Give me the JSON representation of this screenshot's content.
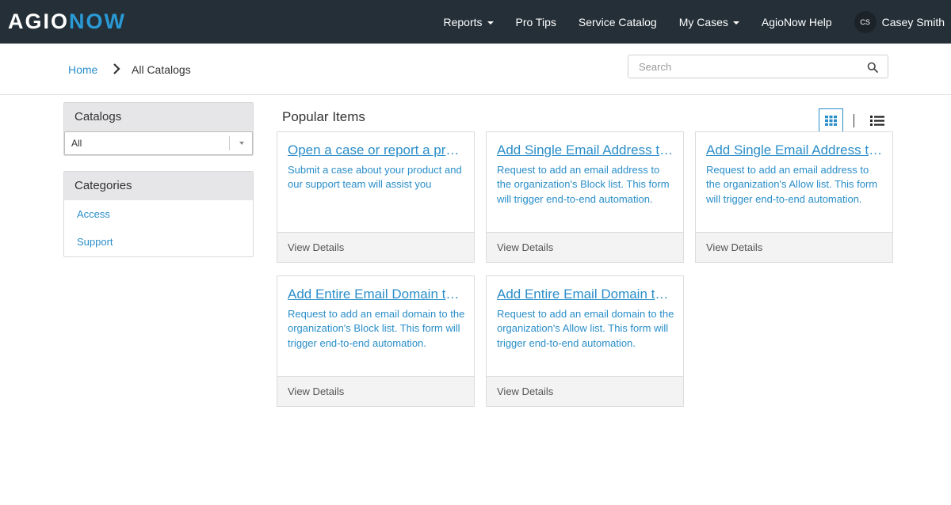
{
  "brand": {
    "part1": "AGIO",
    "part2": "NOW",
    "accent": "#2a9ad6",
    "nav_bg": "#242f37"
  },
  "nav": {
    "items": [
      {
        "label": "Reports",
        "dropdown": true
      },
      {
        "label": "Pro Tips",
        "dropdown": false
      },
      {
        "label": "Service Catalog",
        "dropdown": false
      },
      {
        "label": "My Cases",
        "dropdown": true
      },
      {
        "label": "AgioNow Help",
        "dropdown": false
      }
    ],
    "user": {
      "initials": "CS",
      "name": "Casey Smith"
    }
  },
  "breadcrumb": {
    "home": "Home",
    "current": "All Catalogs",
    "separator_icon": "chevron-right-icon"
  },
  "search": {
    "placeholder": "Search",
    "value": "",
    "icon": "search-icon"
  },
  "sidebar": {
    "catalogs": {
      "title": "Catalogs",
      "selected": "All"
    },
    "categories": {
      "title": "Categories",
      "items": [
        "Access",
        "Support"
      ]
    }
  },
  "main": {
    "title": "Popular Items",
    "view_modes": [
      "grid-view-icon",
      "list-view-icon"
    ],
    "active_view": "grid",
    "cards": [
      {
        "title": "Open a case or report a problem",
        "description": "Submit a case about your product and our support team will assist you",
        "action": "View Details"
      },
      {
        "title": "Add Single Email Address to Block List",
        "description": "Request to add an email address to the organization's Block list. This form will trigger end-to-end automation.",
        "action": "View Details"
      },
      {
        "title": "Add Single Email Address to Allow List",
        "description": "Request to add an email address to the organization's Allow list. This form will trigger end-to-end automation.",
        "action": "View Details"
      },
      {
        "title": "Add Entire Email Domain to Block List",
        "description": "Request to add an email domain to the organization's Block list. This form will trigger end-to-end automation.",
        "action": "View Details"
      },
      {
        "title": "Add Entire Email Domain to Allow List",
        "description": "Request to add an email domain to the organization's Allow list. This form will trigger end-to-end automation.",
        "action": "View Details"
      }
    ]
  }
}
